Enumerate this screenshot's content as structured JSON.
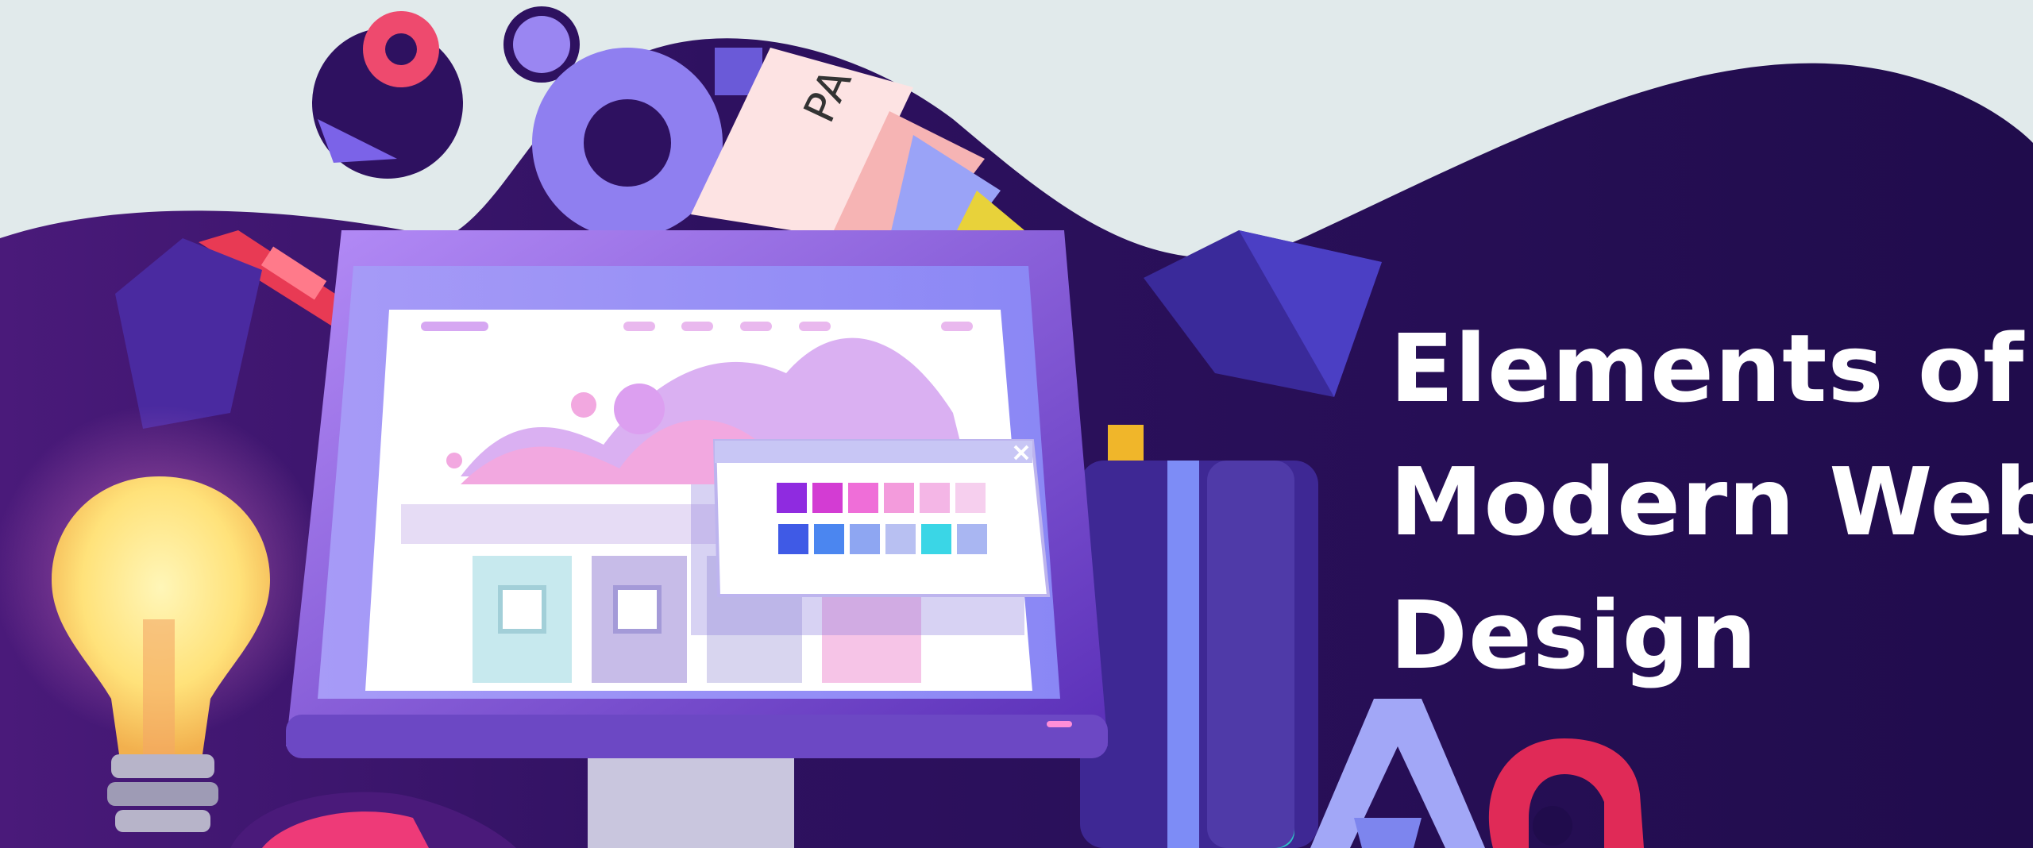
{
  "headline": {
    "line1": "Elements of",
    "line2": "Modern Web",
    "line3": "Design"
  },
  "card": {
    "label": "PA"
  },
  "colors": {
    "background": "#e1eaeb",
    "banner": "#220d4f",
    "accent_purple": "#8a5cf0",
    "accent_pink": "#e45ab5",
    "accent_red": "#e02a57",
    "bulb_yellow": "#ffe27a",
    "headline_text": "#ffffff"
  },
  "icons": [
    "light-bulb-icon",
    "pen-icon",
    "monitor-icon",
    "gear-icon",
    "image-placeholder-icon",
    "close-icon",
    "color-swatch-icon",
    "book-icon",
    "typography-aa-icon",
    "cube-icon"
  ]
}
